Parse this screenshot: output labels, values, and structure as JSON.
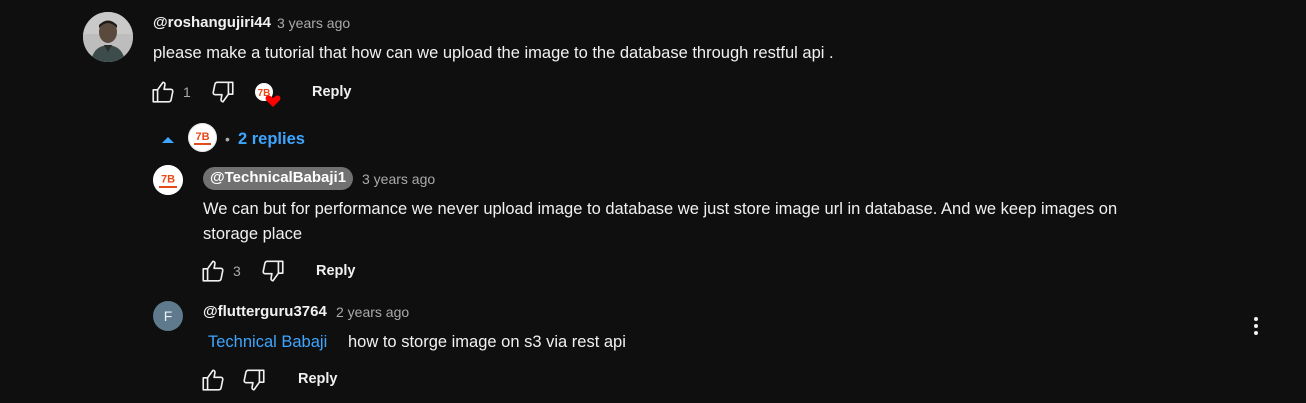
{
  "comment": {
    "author": "@roshangujiri44",
    "time": "3 years ago",
    "text": "please make a tutorial that how can we upload the image to the database through restful api .",
    "likes": "1",
    "reply_label": "Reply"
  },
  "replies_toggle": {
    "dot": "•",
    "label": "2 replies"
  },
  "reply1": {
    "author": "@TechnicalBabaji1",
    "time": "3 years ago",
    "text_line1": "We can but for performance we never upload image to database we just store image url in database. And we keep images on",
    "text_line2": "storage place",
    "likes": "3",
    "reply_label": "Reply",
    "avatar_text": "7B"
  },
  "reply2": {
    "author": "@flutterguru3764",
    "time": "2 years ago",
    "mention": "Technical Babaji",
    "text": "how to storge image on s3 via rest api",
    "reply_label": "Reply",
    "avatar_letter": "F"
  },
  "colors": {
    "background": "#0f0f0f",
    "link": "#3ea6ff",
    "secondary_text": "#aaaaaa",
    "channel_chip": "#717171",
    "heart": "#ff0000",
    "avatar_f": "#5f7a8c"
  },
  "icons": [
    "like-icon",
    "dislike-icon",
    "creator-heart-icon",
    "chevron-up-icon",
    "more-vert-icon"
  ]
}
